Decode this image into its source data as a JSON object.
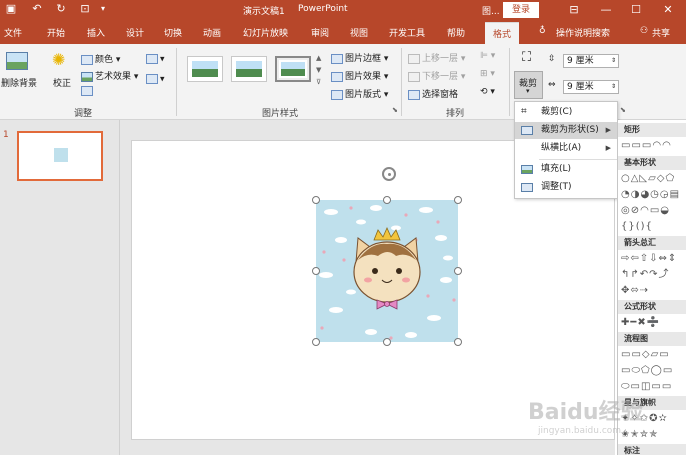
{
  "titlebar": {
    "doc_title": "演示文稿1",
    "app_name": "PowerPoint",
    "context": "图...",
    "login": "登录"
  },
  "tabs": [
    "文件",
    "开始",
    "插入",
    "设计",
    "切换",
    "动画",
    "幻灯片放映",
    "审阅",
    "视图",
    "开发工具",
    "帮助"
  ],
  "active_tab": "格式",
  "tell_me": "操作说明搜索",
  "share": "共享",
  "ribbon": {
    "remove_bg": "删除背景",
    "correct": "校正",
    "color": "颜色",
    "artistic": "艺术效果",
    "group_adjust": "调整",
    "group_style": "图片样式",
    "border": "图片边框",
    "effects": "图片效果",
    "layout": "图片版式",
    "bring_forward": "上移一层",
    "send_backward": "下移一层",
    "selection_pane": "选择窗格",
    "group_arrange": "排列",
    "crop": "裁剪",
    "height": "9 厘米",
    "width": "9 厘米"
  },
  "slide": {
    "number": "1"
  },
  "crop_menu": [
    {
      "label": "裁剪(C)",
      "has_arrow": false
    },
    {
      "label": "裁剪为形状(S)",
      "has_arrow": true
    },
    {
      "label": "纵横比(A)",
      "has_arrow": true
    },
    {
      "label": "填充(L)",
      "has_arrow": false
    },
    {
      "label": "调整(T)",
      "has_arrow": false
    }
  ],
  "shape_categories": [
    "矩形",
    "基本形状",
    "箭头总汇",
    "公式形状",
    "流程图",
    "星与旗帜",
    "标注"
  ],
  "shape_rows": {
    "rect": "▭▭▭◠◠",
    "basic1": "○△◺▱◇⬠",
    "basic2": "◔◑◕◷◶▤",
    "basic3": "◎⊘◠▭◒",
    "basic4": "{}(){",
    "arrow1": "⇨⇦⇧⇩⇔⇕",
    "arrow2": "↰↱↶↷⤴",
    "arrow3": "✥⬄⇢",
    "eq": "✚━✖➗",
    "flow1": "▭▭◇▱▭",
    "flow2": "▭⬭⬠◯▭",
    "flow3": "⬭▭◫▭▭",
    "star1": "✦✧✩✪✫",
    "star2": "✬✭✮✯"
  },
  "watermark": {
    "text": "Baidu经验",
    "url": "jingyan.baidu.com"
  }
}
